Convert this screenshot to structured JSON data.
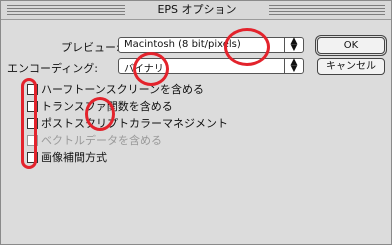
{
  "window": {
    "title": "EPS オプション"
  },
  "preview": {
    "label": "プレビュー:",
    "value": "Macintosh (8 bit/pixels)"
  },
  "encoding": {
    "label": "エンコーディング:",
    "value": "バイナリ"
  },
  "buttons": {
    "ok": "OK",
    "cancel": "キャンセル"
  },
  "options": [
    {
      "label": "ハーフトーンスクリーンを含める",
      "checked": false,
      "enabled": true
    },
    {
      "label": "トランスファ関数を含める",
      "checked": false,
      "enabled": true
    },
    {
      "label": "ポストスクリプトカラーマネジメント",
      "checked": false,
      "enabled": true
    },
    {
      "label": "ベクトルデータを含める",
      "checked": false,
      "enabled": false
    },
    {
      "label": "画像補間方式",
      "checked": false,
      "enabled": true
    }
  ],
  "annotation_color": "#e3232c"
}
